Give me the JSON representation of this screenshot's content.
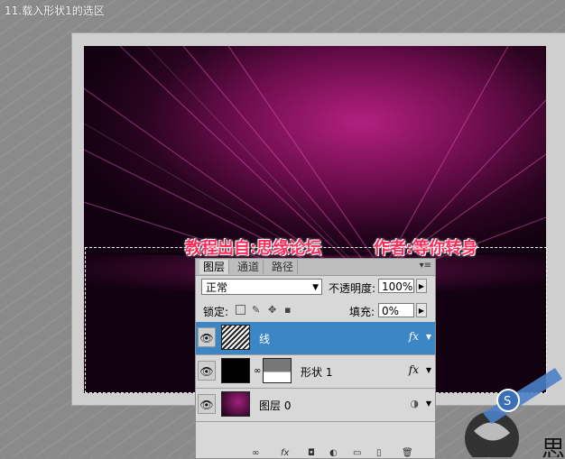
{
  "step_title": "11.载入形状1的选区",
  "canvas": {
    "caption_left": "教程出自:思缘论坛",
    "caption_right": "作者:等你转身"
  },
  "layers_panel": {
    "tabs": [
      "图层",
      "通道",
      "路径"
    ],
    "active_tab": "图层",
    "menu_glyph": "▾≡",
    "blend_mode": "正常",
    "opacity_label": "不透明度:",
    "opacity_value": "100%",
    "lock_label": "锁定:",
    "fill_label": "填充:",
    "fill_value": "0%",
    "layers": [
      {
        "name": "线",
        "selected": true,
        "fx": "fx"
      },
      {
        "name": "形状 1",
        "selected": false,
        "fx": "fx"
      },
      {
        "name": "图层 0",
        "selected": false,
        "fx": ""
      }
    ],
    "bottom_icons": [
      "link-icon",
      "fx-icon",
      "mask-icon",
      "adjustment-icon",
      "group-icon",
      "new-layer-icon",
      "trash-icon"
    ],
    "bottom_fx_label": "fx"
  },
  "colors": {
    "selection": "#3d86c6",
    "caption": "#ff2a5a",
    "canvas_glow": "#b3207f"
  }
}
